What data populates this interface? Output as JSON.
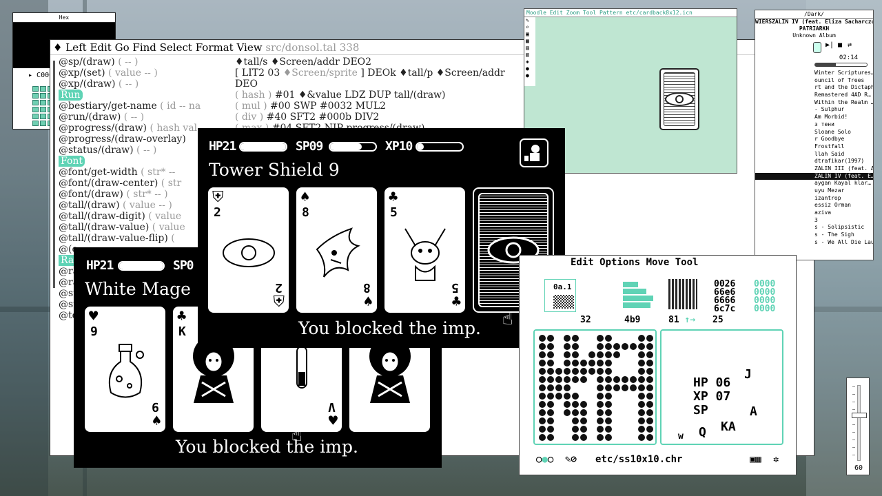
{
  "hex": {
    "title": "Hex",
    "display": "C000"
  },
  "editor": {
    "menu_items": [
      "♦",
      "Left",
      "Edit",
      "Go",
      "Find",
      "Select",
      "Format",
      "View"
    ],
    "file": "src/donsol.tal 338",
    "left_lines": [
      {
        "text": "@sp/(draw)",
        "comment": " ( -- )"
      },
      {
        "text": "@xp/(set)",
        "comment": " ( value -- )"
      },
      {
        "text": "@xp/(draw)",
        "comment": " ( -- )"
      },
      {
        "tag": "Run"
      },
      {
        "text": "@bestiary/get-name",
        "comment": " ( id -- na"
      },
      {
        "text": "@run/(draw)",
        "comment": " ( -- )"
      },
      {
        "text": "@progress/(draw)",
        "comment": " ( hash val"
      },
      {
        "text": "@progress/(draw-overlay)",
        "comment": ""
      },
      {
        "text": "@status/(draw)",
        "comment": " ( -- )"
      },
      {
        "tag": "Font"
      },
      {
        "text": "@font/get-width",
        "comment": " ( str* --"
      },
      {
        "text": "@font/(draw-center)",
        "comment": " ( str"
      },
      {
        "text": "@font/(draw)",
        "comment": " ( str* -- )"
      },
      {
        "text": "@tall/(draw)",
        "comment": " ( value -- )"
      },
      {
        "text": "@tall/(draw-digit)",
        "comment": " ( value"
      },
      {
        "text": "@tall/(draw-value)",
        "comment": " ( value"
      },
      {
        "text": "@tall/(draw-value-flip)",
        "comment": " ("
      },
      {
        "text": "@(c",
        "comment": ""
      },
      {
        "tag": "Ran"
      },
      {
        "text": "@ra",
        "comment": ""
      },
      {
        "text": "@ra",
        "comment": ""
      },
      {
        "text": "@st",
        "comment": ""
      },
      {
        "text": "@st",
        "comment": ""
      },
      {
        "text": "@te",
        "comment": ""
      }
    ],
    "right_lines": [
      {
        "text": "♦tall/s ♦Screen/addr DEO2",
        "comment": ""
      },
      {
        "text": "[ LIT2 03 ",
        "comment": "♦Screen/sprite",
        "tail": " ] DEOk ♦tall/p ♦Screen/addr"
      },
      {
        "text": "DEO",
        "comment": ""
      },
      {
        "text": "",
        "comment": "( hash )",
        "tail": " #01 ♦&value LDZ DUP tall/(draw)"
      },
      {
        "text": "",
        "comment": "( mul )",
        "tail": " #00 SWP #0032 MUL2"
      },
      {
        "text": "",
        "comment": "( div )",
        "tail": " #40 SFT2 #000b DIV2"
      },
      {
        "text": "",
        "comment": "( max )",
        "tail": " #04 SFT2 NIP progress/(draw)"
      }
    ]
  },
  "moodle": {
    "title": "Moodle Edit Zoom Tool Pattern  etc/cardback8x12.icn"
  },
  "music": {
    "title": "/Dark/",
    "artist": "WIERSZALIN IV (feat. Eliza Sacharczu…",
    "line2": "PATRIARKH",
    "line3": "Unknown Album",
    "time": "02:14",
    "tracks": [
      "Winter Scriptures…",
      "ouncil of Trees",
      "rt and the Dictaph…",
      "Remastered 4AD R…",
      "Within the Realm …",
      "- Sulphur",
      "Am Morbid!",
      "з тени",
      "Sloane Solo",
      "r Goodbye",
      "Frostfall",
      "llah Said",
      "dtrafikar(1997)",
      "ZALIN III (feat. A…",
      "ZALIN IV (feat. E…",
      "aygan Kayal klar…",
      "uyu Mezar",
      "izantrop",
      "essiz Orman",
      "aziva",
      "3",
      "s - Solipsistic",
      "s - The Sigh",
      "s - We All Die Lau…"
    ],
    "selected_index": 14
  },
  "game_back": {
    "hp_label": "HP21",
    "sp_label": "SP0",
    "title": "White  Mage",
    "message": "You blocked the imp.",
    "cards": [
      {
        "suit": "♥",
        "rank": "9",
        "rsuit": "♠",
        "rrank": "9",
        "art": "potion"
      },
      {
        "suit": "♣",
        "rank": "K",
        "rsuit": "",
        "rrank": "",
        "art": "mage"
      },
      {
        "suit": "",
        "rank": "",
        "rsuit": "♥",
        "rrank": "V",
        "art": "vial"
      },
      {
        "suit": "",
        "rank": "",
        "rsuit": "",
        "rrank": "",
        "art": "mage"
      }
    ]
  },
  "game_front": {
    "hp_label": "HP21",
    "sp_label": "SP09",
    "xp_label": "XP10",
    "hp_level": 1.0,
    "sp_level": 0.7,
    "xp_level": 0.15,
    "title": "Tower  Shield  9",
    "message": "You blocked the imp.",
    "cards": [
      {
        "suit": "⛨",
        "rank": "2",
        "rsuit": "⛨",
        "rrank": "2",
        "art": "eye"
      },
      {
        "suit": "♠",
        "rank": "8",
        "rsuit": "♠",
        "rrank": "8",
        "art": "bird"
      },
      {
        "suit": "♣",
        "rank": "5",
        "rsuit": "♣",
        "rrank": "5",
        "art": "imp"
      }
    ]
  },
  "nasu": {
    "menu": "Edit Options Move Tool",
    "labels": [
      "32",
      "4b9",
      "81",
      "25"
    ],
    "hexcol1": "0026\n66e6\n6666\n6c7c",
    "hexcol2": "0000\n0000\n0000\n0000",
    "tile_label": "0a.1",
    "sprites": {
      "hp": "HP 06",
      "xp": "XP 07",
      "sp": "SP",
      "j": "J",
      "a": "A",
      "ka": "KA",
      "w": "w",
      "q": "Q"
    },
    "footer_file": "etc/ss10x10.chr",
    "accent": "#5fd3b5"
  },
  "slider": {
    "label": "60",
    "level": 0.6
  }
}
